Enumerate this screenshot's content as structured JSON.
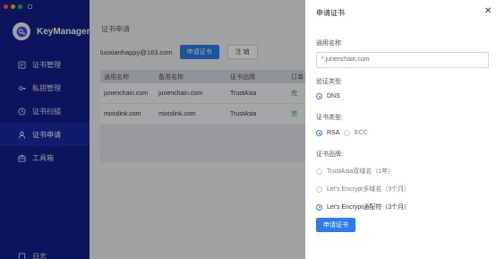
{
  "app": {
    "name": "KeyManager",
    "colors": {
      "sidebar": "#141e8c",
      "primary": "#2f7ce5",
      "success": "#17a34a"
    }
  },
  "sidebar": {
    "items": [
      {
        "label": "证书管理",
        "icon": "certificate-icon"
      },
      {
        "label": "私钥管理",
        "icon": "key-icon"
      },
      {
        "label": "证书扫描",
        "icon": "clock-icon"
      },
      {
        "label": "证书申请",
        "icon": "user-icon",
        "active": true
      },
      {
        "label": "工具箱",
        "icon": "toolbox-icon"
      }
    ],
    "bottom": {
      "label": "日志",
      "icon": "log-icon"
    }
  },
  "main": {
    "title": "证书申请",
    "email": "luoxianhappy@163.com",
    "apply_button": "申请证书",
    "logout_button": "注 销",
    "table": {
      "headers": [
        "通用名称",
        "备用名称",
        "证书品牌",
        "订单"
      ],
      "rows": [
        [
          "junenchain.com",
          "junenchain.com",
          "TrustAsia",
          "完"
        ],
        [
          "mixislink.com",
          "mixislink.com",
          "TrustAsia",
          "完"
        ]
      ]
    }
  },
  "drawer": {
    "title": "申请证书",
    "common_name_label": "通用名称:",
    "common_name_value": "*.junenchain.com",
    "verify_label": "验证类型:",
    "verify_options": [
      {
        "label": "DNS",
        "selected": true
      }
    ],
    "cert_type_label": "证书类型:",
    "cert_type_options": [
      {
        "label": "RSA",
        "selected": true
      },
      {
        "label": "ECC",
        "selected": false
      }
    ],
    "brand_label": "证书品牌:",
    "brand_options": [
      {
        "label": "TrustAsia双域名（1年）",
        "selected": false
      },
      {
        "label": "Let's Encrypt多域名（3个月）",
        "selected": false
      },
      {
        "label": "Let's Encrypt通配符（3个月）",
        "selected": true
      }
    ],
    "submit_button": "申请证书"
  }
}
